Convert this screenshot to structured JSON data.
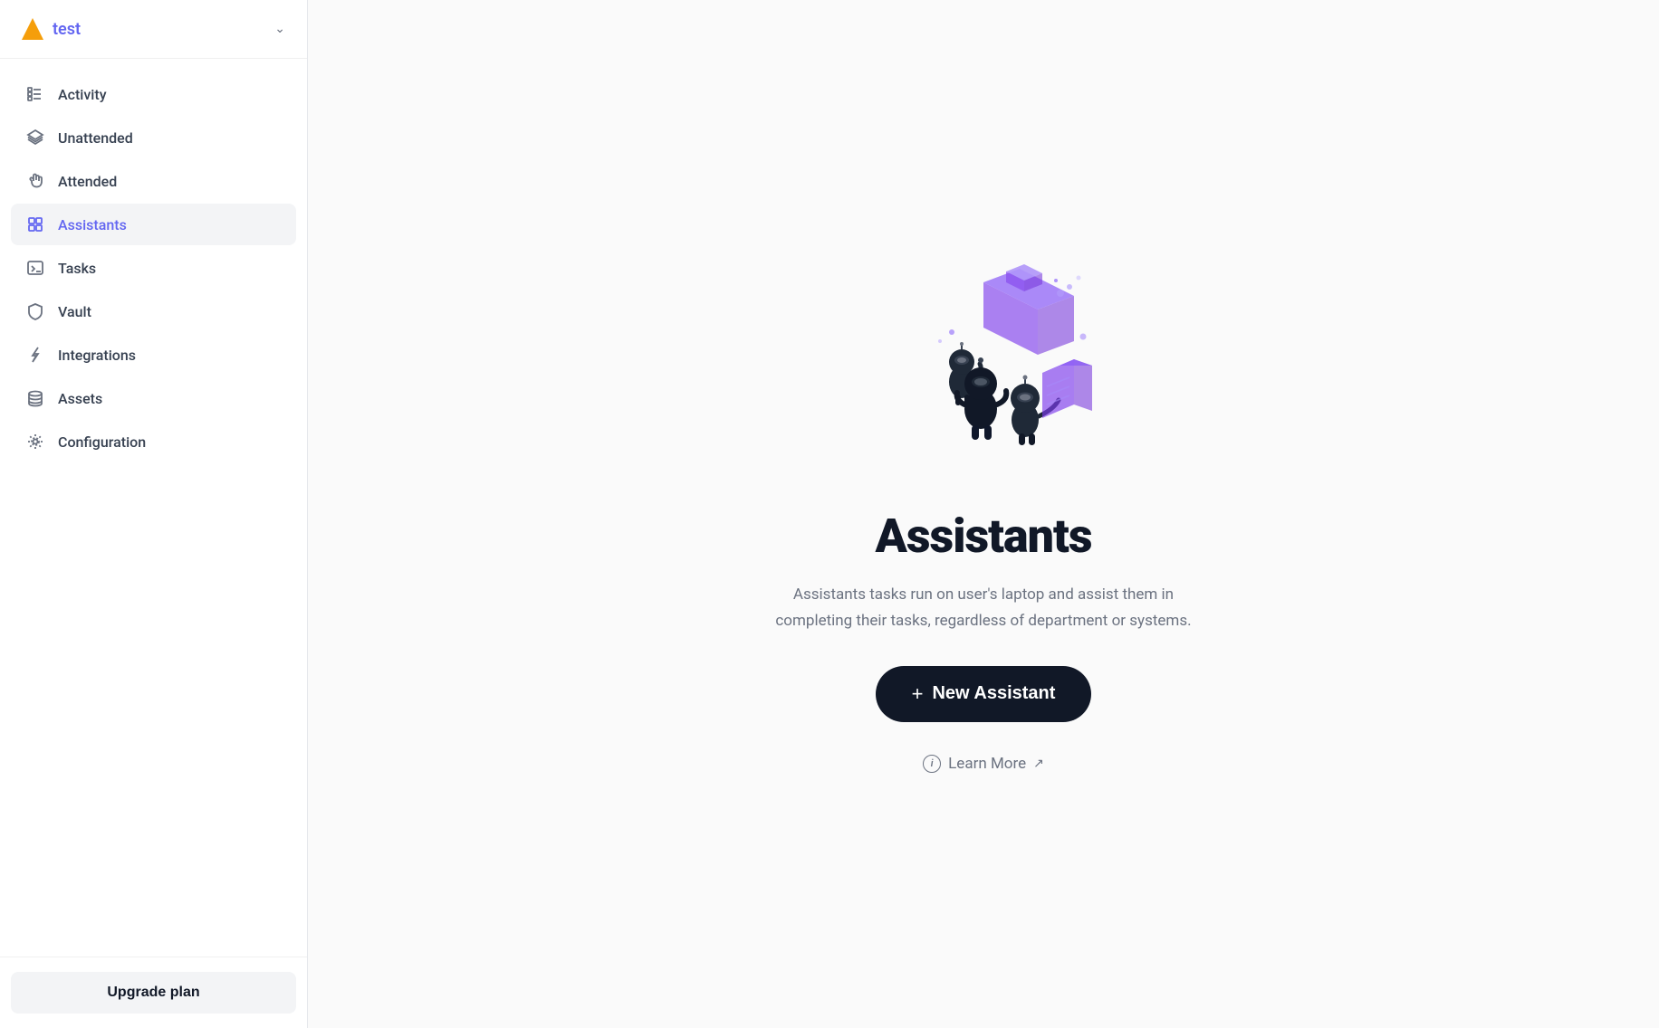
{
  "sidebar": {
    "workspace": {
      "name": "test",
      "warning_icon": "warning-triangle"
    },
    "nav_items": [
      {
        "id": "activity",
        "label": "Activity",
        "icon": "list-icon",
        "active": false
      },
      {
        "id": "unattended",
        "label": "Unattended",
        "icon": "layers-icon",
        "active": false
      },
      {
        "id": "attended",
        "label": "Attended",
        "icon": "hand-icon",
        "active": false
      },
      {
        "id": "assistants",
        "label": "Assistants",
        "icon": "assistants-icon",
        "active": true
      },
      {
        "id": "tasks",
        "label": "Tasks",
        "icon": "terminal-icon",
        "active": false
      },
      {
        "id": "vault",
        "label": "Vault",
        "icon": "shield-icon",
        "active": false
      },
      {
        "id": "integrations",
        "label": "Integrations",
        "icon": "bolt-icon",
        "active": false
      },
      {
        "id": "assets",
        "label": "Assets",
        "icon": "database-icon",
        "active": false
      },
      {
        "id": "configuration",
        "label": "Configuration",
        "icon": "settings-icon",
        "active": false
      }
    ],
    "footer": {
      "upgrade_label": "Upgrade plan"
    }
  },
  "main": {
    "title": "Assistants",
    "description": "Assistants tasks run on user's laptop and assist them in completing their tasks, regardless of department or systems.",
    "new_assistant_label": "New Assistant",
    "learn_more_label": "Learn More"
  }
}
